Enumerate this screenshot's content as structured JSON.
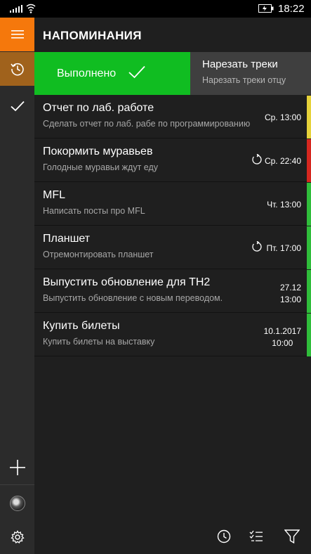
{
  "status_bar": {
    "time": "18:22"
  },
  "header": {
    "title": "НАПОМИНАНИЯ"
  },
  "swipe": {
    "action_label": "Выполнено",
    "action_color": "#10bd21",
    "item_title": "Нарезать треки",
    "item_subtitle": "Нарезать треки отцу"
  },
  "reminders": [
    {
      "title": "Отчет по лаб. работе",
      "subtitle": "Сделать отчет по лаб. рабе по программированию",
      "date": "Ср. 13:00",
      "date2": "",
      "repeat": false,
      "color": "#e6d23a"
    },
    {
      "title": "Покормить муравьев",
      "subtitle": "Голодные муравьи ждут еду",
      "date": "Ср. 22:40",
      "date2": "",
      "repeat": true,
      "color": "#d6271f"
    },
    {
      "title": "MFL",
      "subtitle": "Написать посты про MFL",
      "date": "Чт. 13:00",
      "date2": "",
      "repeat": false,
      "color": "#2fbd3a"
    },
    {
      "title": "Планшет",
      "subtitle": "Отремонтировать планшет",
      "date": "Пт. 17:00",
      "date2": "",
      "repeat": true,
      "color": "#2fbd3a"
    },
    {
      "title": "Выпустить обновление для TH2",
      "subtitle": "Выпустить обновление с новым переводом.",
      "date": "27.12",
      "date2": "13:00",
      "repeat": false,
      "color": "#2fbd3a"
    },
    {
      "title": "Купить билеты",
      "subtitle": "Купить билеты на выставку",
      "date": "10.1.2017",
      "date2": "10:00",
      "repeat": false,
      "color": "#2fbd3a"
    }
  ],
  "icons": {
    "menu": "hamburger-icon",
    "history": "history-icon",
    "completed": "checkmark-icon",
    "add": "plus-icon",
    "avatar": "avatar",
    "settings": "gear-icon",
    "sort_time": "clock-icon",
    "select": "checklist-icon",
    "filter": "filter-icon"
  },
  "colors": {
    "accent": "#f5780c",
    "history_bg": "#a0621c",
    "sidebar": "#2b2b2b",
    "background": "#1f1f1f"
  }
}
